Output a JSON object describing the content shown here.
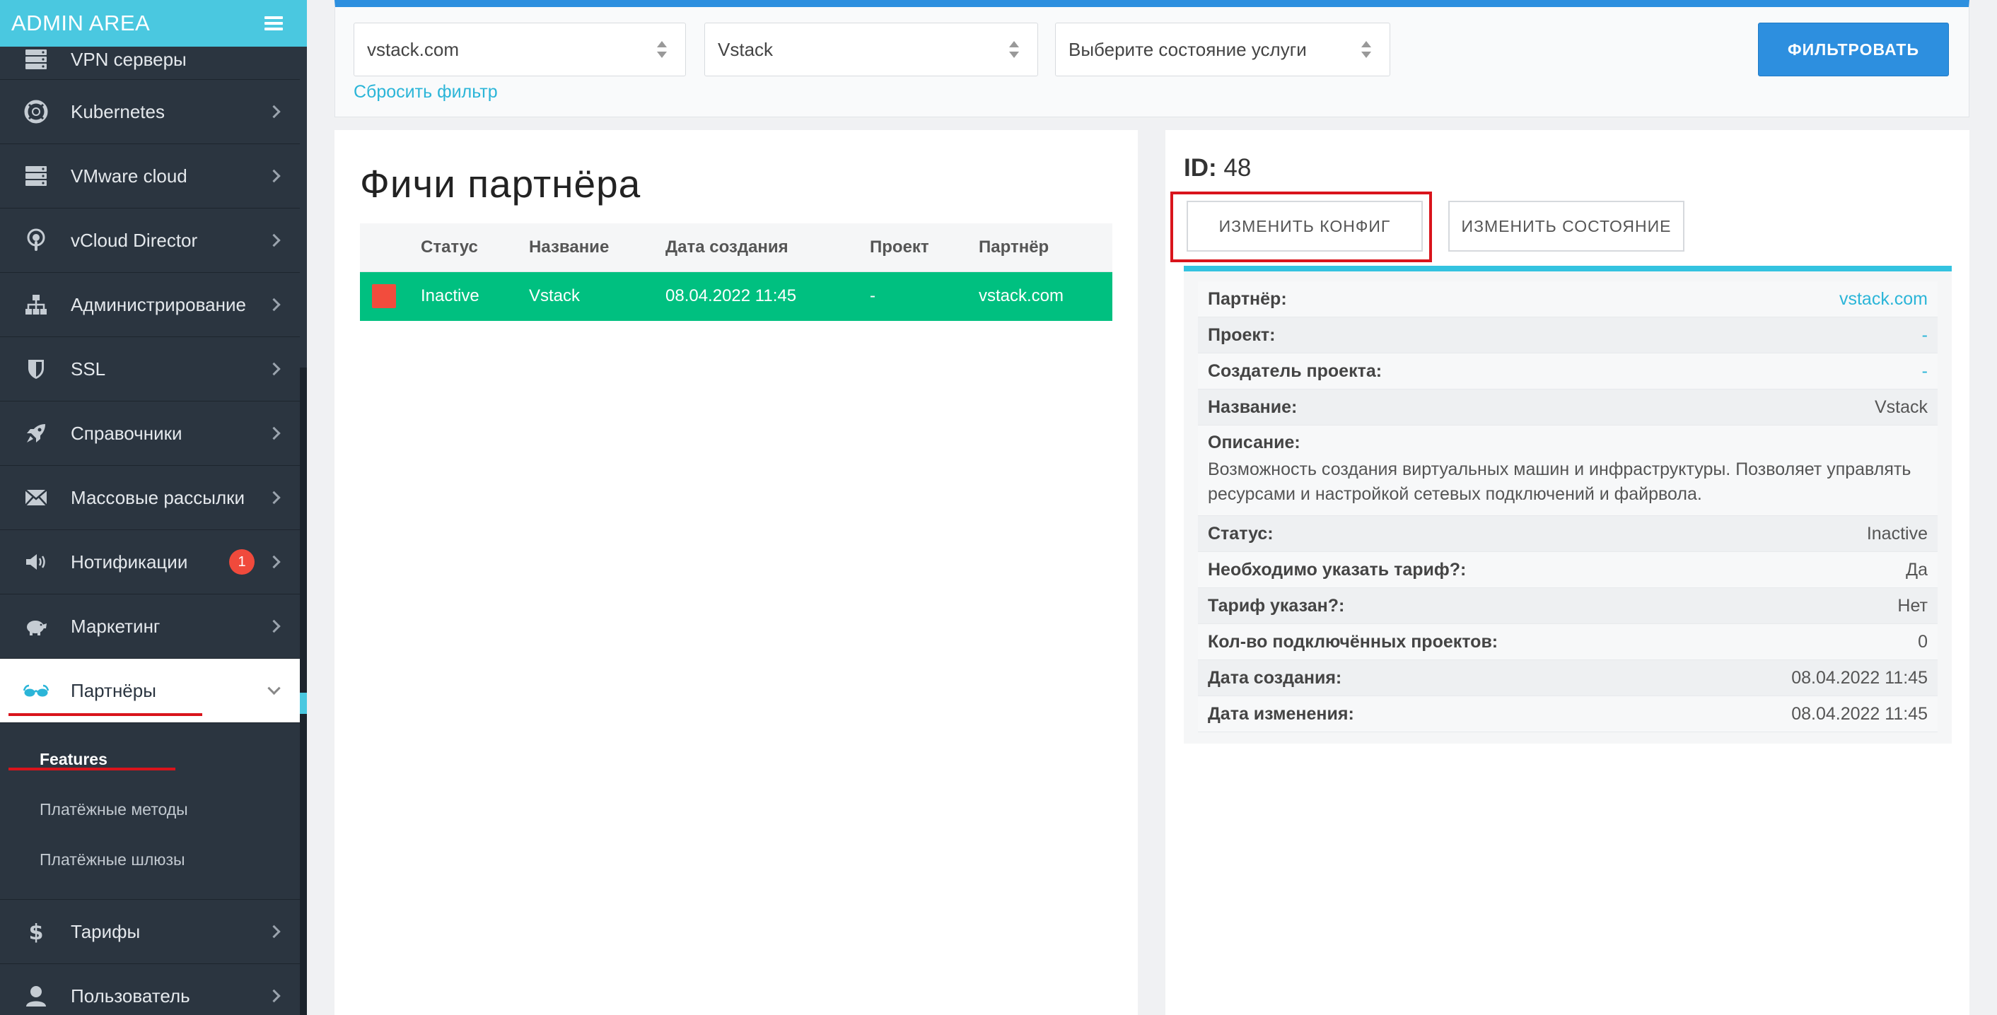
{
  "sidebar": {
    "brand": "ADMIN AREA",
    "items": [
      {
        "label": "VPN серверы",
        "icon": "server-stack-icon"
      },
      {
        "label": "Kubernetes",
        "icon": "lifebuoy-icon"
      },
      {
        "label": "VMware cloud",
        "icon": "server-stack-icon"
      },
      {
        "label": "vCloud Director",
        "icon": "podcast-icon"
      },
      {
        "label": "Администрирование",
        "icon": "sitemap-icon"
      },
      {
        "label": "SSL",
        "icon": "shield-icon"
      },
      {
        "label": "Справочники",
        "icon": "rocket-icon"
      },
      {
        "label": "Массовые рассылки",
        "icon": "envelope-icon"
      },
      {
        "label": "Нотификации",
        "icon": "megaphone-icon",
        "badge": "1"
      },
      {
        "label": "Маркетинг",
        "icon": "piggy-bank-icon"
      },
      {
        "label": "Партнёры",
        "icon": "glasses-icon"
      },
      {
        "label": "Тарифы",
        "icon": "dollar-icon"
      },
      {
        "label": "Пользователь",
        "icon": "user-icon"
      }
    ],
    "partners_sub": [
      {
        "label": "Features"
      },
      {
        "label": "Платёжные методы"
      },
      {
        "label": "Платёжные шлюзы"
      }
    ]
  },
  "filter": {
    "partner_value": "vstack.com",
    "product_value": "Vstack",
    "state_placeholder": "Выберите состояние услуги",
    "reset_label": "Сбросить фильтр",
    "submit_label": "ФИЛЬТРОВАТЬ"
  },
  "features": {
    "title": "Фичи партнёра",
    "columns": [
      "",
      "Статус",
      "Название",
      "Дата создания",
      "Проект",
      "Партнёр"
    ],
    "rows": [
      {
        "status": "Inactive",
        "name": "Vstack",
        "created": "08.04.2022 11:45",
        "project": "-",
        "partner": "vstack.com"
      }
    ]
  },
  "detail": {
    "id_label": "ID:",
    "id_value": "48",
    "edit_config_label": "ИЗМЕНИТЬ КОНФИГ",
    "edit_state_label": "ИЗМЕНИТЬ СОСТОЯНИЕ",
    "fields": [
      {
        "label": "Партнёр:",
        "value": "vstack.com"
      },
      {
        "label": "Проект:",
        "value": "-"
      },
      {
        "label": "Создатель проекта:",
        "value": "-"
      },
      {
        "label": "Название:",
        "value": "Vstack"
      },
      {
        "label": "Описание:",
        "value": "Возможность создания виртуальных машин и инфраструктуры. Позволяет управлять ресурсами и настройкой сетевых подключений и файрвола."
      },
      {
        "label": "Статус:",
        "value": "Inactive"
      },
      {
        "label": "Необходимо указать тариф?:",
        "value": "Да"
      },
      {
        "label": "Тариф указан?:",
        "value": "Нет"
      },
      {
        "label": "Кол-во подключённых проектов:",
        "value": "0"
      },
      {
        "label": "Дата создания:",
        "value": "08.04.2022 11:45"
      },
      {
        "label": "Дата изменения:",
        "value": "08.04.2022 11:45"
      }
    ]
  },
  "colors": {
    "sidebar_bg": "#2b3540",
    "accent_cyan": "#4ac8e0",
    "primary_blue": "#2d8fdf",
    "row_green": "#00c080",
    "status_red": "#f24c3d",
    "annotation_red": "#d9141c"
  }
}
